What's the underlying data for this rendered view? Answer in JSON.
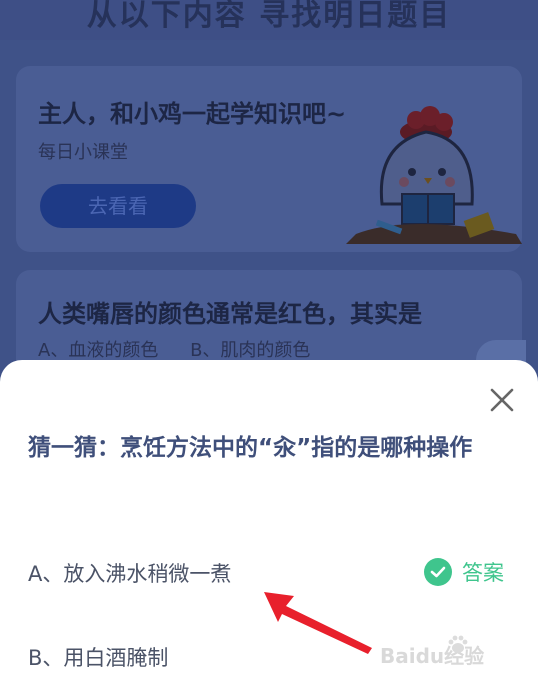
{
  "background": {
    "header_title": "从以下内容 寻找明日题目",
    "card1": {
      "title": "主人，和小鸡一起学知识吧~",
      "subtitle": "每日小课堂",
      "button_label": "去看看"
    },
    "card2": {
      "title": "人类嘴唇的颜色通常是红色，其实是",
      "option_a": "A、血液的颜色",
      "option_b": "B、肌肉的颜色"
    }
  },
  "sheet": {
    "question": "猜一猜：烹饪方法中的“汆”指的是哪种操作",
    "options": [
      {
        "label": "A、放入沸水稍微一煮",
        "is_answer": true
      },
      {
        "label": "B、用白酒腌制",
        "is_answer": false
      }
    ],
    "answer_label": "答案",
    "close_icon": "close-icon",
    "answer_color": "#3fc58d"
  },
  "watermark": {
    "text": "Baidu经验"
  }
}
